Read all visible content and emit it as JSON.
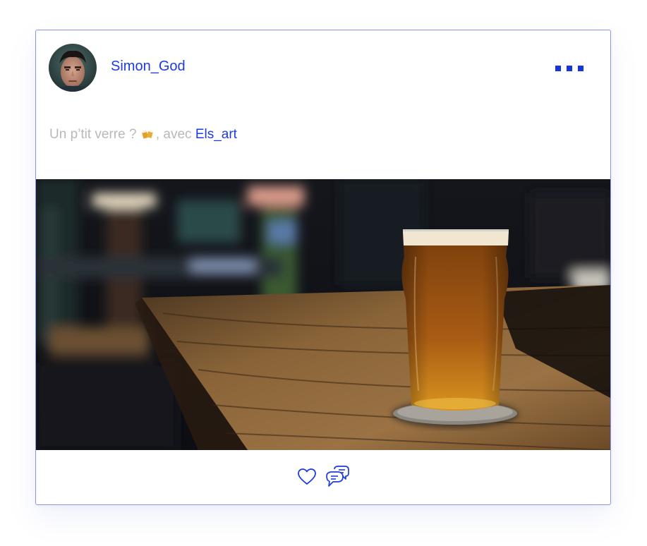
{
  "post": {
    "author": {
      "username": "Simon_God",
      "avatar_icon": "avatar-photo"
    },
    "more_options_icon": "three-dots-icon",
    "caption": {
      "text_before": "Un p’tit verre ? ",
      "emoji_icon": "beer-mugs-icon",
      "text_after": ", avec ",
      "mention": "Els_art"
    },
    "image": {
      "description_icon": "beer-glass-on-bar-photo"
    },
    "actions": {
      "like_icon": "heart-icon",
      "comment_icon": "chat-bubbles-icon"
    }
  },
  "colors": {
    "accent": "#1c3be0",
    "caption_gray": "#b8b8bd",
    "border": "#8a97e6",
    "background": "#ffffff"
  }
}
